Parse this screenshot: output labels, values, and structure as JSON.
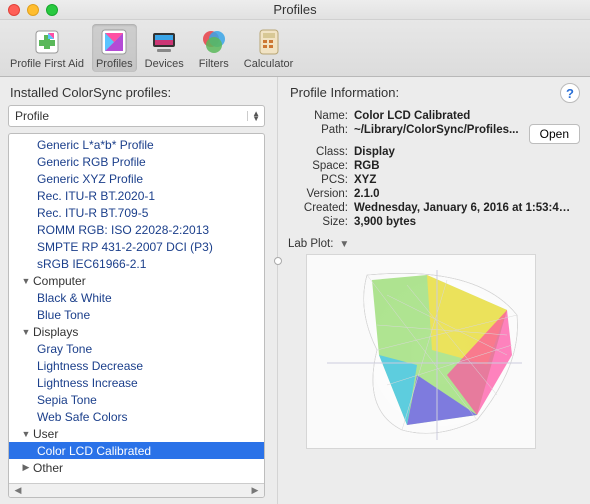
{
  "window": {
    "title": "Profiles"
  },
  "toolbar": {
    "items": [
      {
        "name": "profile-first-aid",
        "label": "Profile First Aid"
      },
      {
        "name": "profiles",
        "label": "Profiles"
      },
      {
        "name": "devices",
        "label": "Devices"
      },
      {
        "name": "filters",
        "label": "Filters"
      },
      {
        "name": "calculator",
        "label": "Calculator"
      }
    ],
    "selected": "profiles"
  },
  "leftPane": {
    "header": "Installed ColorSync profiles:",
    "dropdown": {
      "label": "Profile"
    },
    "rootItems": [
      "Generic L*a*b* Profile",
      "Generic RGB Profile",
      "Generic XYZ Profile",
      "Rec. ITU-R BT.2020-1",
      "Rec. ITU-R BT.709-5",
      "ROMM RGB: ISO 22028-2:2013",
      "SMPTE RP 431-2-2007 DCI (P3)",
      "sRGB IEC61966-2.1"
    ],
    "groups": [
      {
        "name": "Computer",
        "items": [
          "Black & White",
          "Blue Tone"
        ]
      },
      {
        "name": "Displays",
        "items": [
          "Gray Tone",
          "Lightness Decrease",
          "Lightness Increase",
          "Sepia Tone",
          "Web Safe Colors"
        ]
      },
      {
        "name": "User",
        "items": [
          "Color LCD Calibrated"
        ]
      },
      {
        "name": "Other",
        "items": []
      }
    ],
    "selectedItem": "Color LCD Calibrated"
  },
  "rightPane": {
    "header": "Profile Information:",
    "openLabel": "Open",
    "fields": {
      "nameLabel": "Name:",
      "nameValue": "Color LCD Calibrated",
      "pathLabel": "Path:",
      "pathValue": "~/Library/ColorSync/Profiles...",
      "classLabel": "Class:",
      "classValue": "Display",
      "spaceLabel": "Space:",
      "spaceValue": "RGB",
      "pcsLabel": "PCS:",
      "pcsValue": "XYZ",
      "versionLabel": "Version:",
      "versionValue": "2.1.0",
      "createdLabel": "Created:",
      "createdValue": "Wednesday, January 6, 2016 at 1:53:4…",
      "sizeLabel": "Size:",
      "sizeValue": "3,900 bytes"
    },
    "labPlotLabel": "Lab Plot:"
  }
}
